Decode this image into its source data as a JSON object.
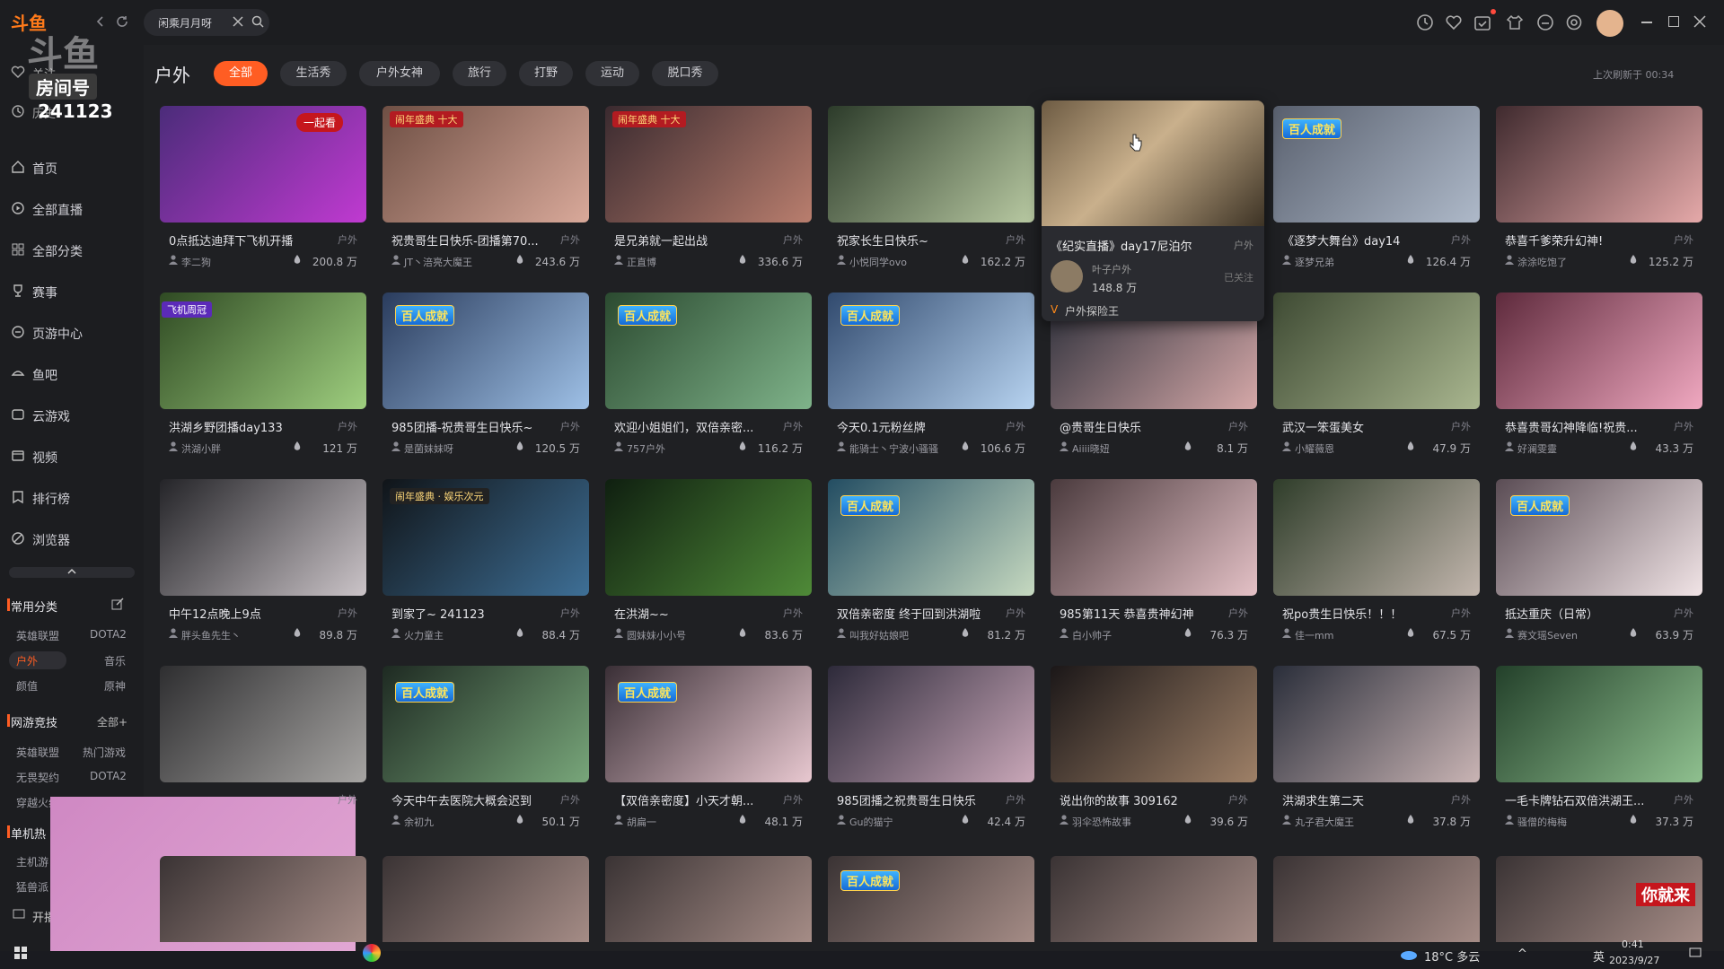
{
  "topbar": {
    "logo_text": "斗鱼",
    "search_value": "闲乘月月呀",
    "icons": [
      "history-icon",
      "heart-icon",
      "calendar-icon",
      "shirt-icon",
      "message-icon",
      "settings-icon"
    ],
    "window_controls": [
      "minimize-icon",
      "maximize-icon",
      "close-icon"
    ]
  },
  "room_badge": {
    "brand": "斗鱼",
    "label": "房间号",
    "number": "241123"
  },
  "sidebar": {
    "top_items": [
      {
        "label": "关注"
      },
      {
        "label": "历史"
      }
    ],
    "items": [
      {
        "label": "首页",
        "icon": "home-icon"
      },
      {
        "label": "全部直播",
        "icon": "live-icon"
      },
      {
        "label": "全部分类",
        "icon": "grid-icon"
      },
      {
        "label": "赛事",
        "icon": "trophy-icon"
      },
      {
        "label": "页游中心",
        "icon": "gamepad-icon"
      },
      {
        "label": "鱼吧",
        "icon": "fish-icon"
      },
      {
        "label": "云游戏",
        "icon": "cloud-game-icon"
      },
      {
        "label": "视频",
        "icon": "video-icon"
      },
      {
        "label": "排行榜",
        "icon": "rank-icon"
      },
      {
        "label": "浏览器",
        "icon": "browser-icon"
      }
    ],
    "sections": {
      "common": {
        "title": "常用分类",
        "tags": [
          [
            "英雄联盟",
            "DOTA2"
          ],
          [
            "户外",
            "音乐"
          ],
          [
            "颜值",
            "原神"
          ]
        ]
      },
      "online": {
        "title": "网游竞技",
        "more": "全部+",
        "tags": [
          [
            "英雄联盟",
            "热门游戏"
          ],
          [
            "无畏契约",
            "DOTA2"
          ],
          [
            "穿越火线",
            ""
          ]
        ]
      },
      "single": {
        "title": "单机热",
        "tags": [
          [
            "主机游",
            ""
          ],
          [
            "猛兽派",
            ""
          ]
        ]
      },
      "open_label": "开播"
    }
  },
  "main": {
    "section_title": "户外",
    "chips": [
      "全部",
      "生活秀",
      "户外女神",
      "旅行",
      "打野",
      "运动",
      "脱口秀"
    ],
    "active_chip": "全部",
    "refresh_text": "上次刷新于 00:34",
    "cards": [
      {
        "title": "0点抵达迪拜下飞机开播",
        "cat": "户外",
        "streamer": "李二狗",
        "viewers": "200.8 万"
      },
      {
        "title": "祝贵哥生日快乐-团播第70...",
        "cat": "户外",
        "streamer": "JT丶涪亮大魔王",
        "viewers": "243.6 万"
      },
      {
        "title": "是兄弟就一起出战",
        "cat": "户外",
        "streamer": "正直博",
        "viewers": "336.6 万"
      },
      {
        "title": "祝家长生日快乐~",
        "cat": "户外",
        "streamer": "小悦同学ovo",
        "viewers": "162.2 万"
      },
      {
        "title": "《纪实直播》day17尼泊尔",
        "cat": "户外",
        "streamer": "叶子户外",
        "viewers": "148.8 万"
      },
      {
        "title": "《逐梦大舞台》day14",
        "cat": "户外",
        "streamer": "逐梦兄弟",
        "viewers": "126.4 万"
      },
      {
        "title": "恭喜千爹荣升幻神!",
        "cat": "户外",
        "streamer": "涂涂吃饱了",
        "viewers": "125.2 万"
      },
      {
        "title": "洪湖乡野团播day133",
        "cat": "户外",
        "streamer": "洪湖小胖",
        "viewers": "121 万"
      },
      {
        "title": "985团播-祝贵哥生日快乐~",
        "cat": "户外",
        "streamer": "是菌妹妹呀",
        "viewers": "120.5 万"
      },
      {
        "title": "欢迎小姐姐们，双倍亲密...",
        "cat": "户外",
        "streamer": "757户外",
        "viewers": "116.2 万"
      },
      {
        "title": "今天0.1元粉丝牌",
        "cat": "户外",
        "streamer": "能骑士丶宁波小骚骚",
        "viewers": "106.6 万"
      },
      {
        "title": "@贵哥生日快乐",
        "cat": "户外",
        "streamer": "Aiiii晓妞",
        "viewers": "8.1 万"
      },
      {
        "title": "武汉一笨蛋美女",
        "cat": "户外",
        "streamer": "小耀薇恩",
        "viewers": "47.9 万"
      },
      {
        "title": "恭喜贵哥幻神降临!祝贵...",
        "cat": "户外",
        "streamer": "好澜雯靈",
        "viewers": "43.3 万"
      },
      {
        "title": "中午12点晚上9点",
        "cat": "户外",
        "streamer": "胖头鱼先生丶",
        "viewers": "89.8 万"
      },
      {
        "title": "到家了~ 241123",
        "cat": "户外",
        "streamer": "火力童主",
        "viewers": "88.4 万"
      },
      {
        "title": "在洪湖~~",
        "cat": "户外",
        "streamer": "圆妹妹小小号",
        "viewers": "83.6 万"
      },
      {
        "title": "双倍亲密度 终于回到洪湖啦",
        "cat": "户外",
        "streamer": "叫我好姑娘吧",
        "viewers": "81.2 万"
      },
      {
        "title": "985第11天 恭喜贵神幻神",
        "cat": "户外",
        "streamer": "白小帅子",
        "viewers": "76.3 万"
      },
      {
        "title": "祝po贵生日快乐！！！",
        "cat": "户外",
        "streamer": "佳一mm",
        "viewers": "67.5 万"
      },
      {
        "title": "抵达重庆（日常）",
        "cat": "户外",
        "streamer": "赛文瑶Seven",
        "viewers": "63.9 万"
      },
      {
        "title": "",
        "cat": "户外",
        "streamer": "",
        "viewers": ""
      },
      {
        "title": "今天中午去医院大概会迟到",
        "cat": "户外",
        "streamer": "余初九",
        "viewers": "50.1 万"
      },
      {
        "title": "【双倍亲密度】小天才朝...",
        "cat": "户外",
        "streamer": "胡扁一",
        "viewers": "48.1 万"
      },
      {
        "title": "985团播之祝贵哥生日快乐",
        "cat": "户外",
        "streamer": "Gu的猫宁",
        "viewers": "42.4 万"
      },
      {
        "title": "说出你的故事 309162",
        "cat": "户外",
        "streamer": "羽伞恐怖故事",
        "viewers": "39.6 万"
      },
      {
        "title": "洪湖求生第二天",
        "cat": "户外",
        "streamer": "丸子君大魔王",
        "viewers": "37.8 万"
      },
      {
        "title": "一毛卡牌钻石双倍洪湖王...",
        "cat": "户外",
        "streamer": "骚僧的梅梅",
        "viewers": "37.3 万"
      }
    ],
    "badges": {
      "rally": "一起看",
      "gala_top10": "闹年盛典 十大",
      "hundred_achievement": "百人成就",
      "gala_music": "闹年盛典 · 娱乐次元",
      "fly_champion": "飞机周冠"
    },
    "hover_card": {
      "title": "《纪实直播》day17尼泊尔",
      "cat": "户外",
      "streamer": "叶子户外",
      "viewers": "148.8 万",
      "follow_state": "已关注",
      "tag": "户外探险王"
    },
    "bottom_row_overlay": "你就来"
  },
  "taskbar": {
    "weather": "18°C 多云",
    "ime": "英",
    "time": "0:41",
    "date": "2023/9/27"
  }
}
